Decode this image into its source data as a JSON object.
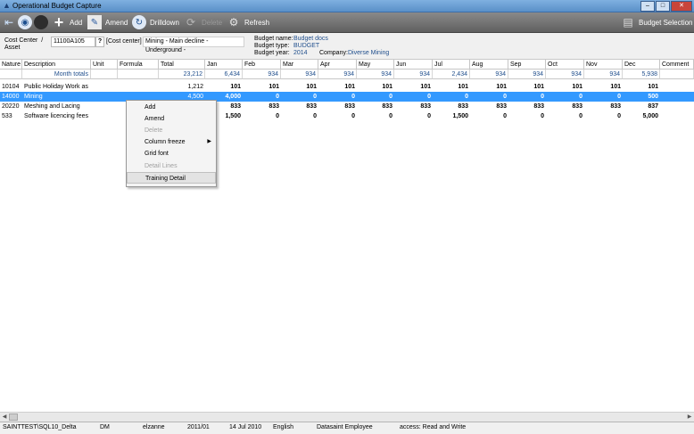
{
  "window": {
    "title": "Operational Budget Capture"
  },
  "toolbar": {
    "add": "Add",
    "amend": "Amend",
    "drilldown": "Drilldown",
    "delete": "Delete",
    "refresh": "Refresh",
    "budget_selection": "Budget Selection"
  },
  "header": {
    "cost_center_label": "Cost Center  /\nAsset",
    "cost_center_code": "11100A105",
    "cost_center_type": "[Cost center]",
    "cost_center_desc": "Mining - Main decline - Underground -",
    "budget_name_label": "Budget name:",
    "budget_name": "Budget docs",
    "budget_type_label": "Budget type:",
    "budget_type": "BUDGET",
    "budget_year_label": "Budget year:",
    "budget_year": "2014",
    "company_label": "Company:",
    "company": "Diverse Mining"
  },
  "grid": {
    "columns": [
      "Nature",
      "Description",
      "Unit",
      "Formula",
      "Total",
      "Jan",
      "Feb",
      "Mar",
      "Apr",
      "May",
      "Jun",
      "Jul",
      "Aug",
      "Sep",
      "Oct",
      "Nov",
      "Dec",
      "Comment"
    ],
    "totals": [
      "",
      "Month totals",
      "",
      "",
      "23,212",
      "6,434",
      "934",
      "934",
      "934",
      "934",
      "934",
      "2,434",
      "934",
      "934",
      "934",
      "934",
      "5,938",
      ""
    ],
    "rows": [
      [
        "10104",
        "Public Holiday Work as",
        "",
        "",
        "1,212",
        "101",
        "101",
        "101",
        "101",
        "101",
        "101",
        "101",
        "101",
        "101",
        "101",
        "101",
        "101",
        ""
      ],
      [
        "14000",
        "Mining",
        "",
        "",
        "4,500",
        "4,000",
        "0",
        "0",
        "0",
        "0",
        "0",
        "0",
        "0",
        "0",
        "0",
        "0",
        "500",
        ""
      ],
      [
        "20220",
        "Meshing and Lacing",
        "",
        "",
        "",
        "833",
        "833",
        "833",
        "833",
        "833",
        "833",
        "833",
        "833",
        "833",
        "833",
        "833",
        "837",
        ""
      ],
      [
        "533",
        "Software licencing fees",
        "",
        "",
        "",
        "1,500",
        "0",
        "0",
        "0",
        "0",
        "0",
        "1,500",
        "0",
        "0",
        "0",
        "0",
        "5,000",
        ""
      ]
    ]
  },
  "context_menu": {
    "items": [
      "Add",
      "Amend",
      "Delete",
      "Column freeze",
      "Grid font",
      "Detail Lines",
      "Training Detail"
    ]
  },
  "status": {
    "server": "SAINTTEST\\SQL10_Delta",
    "code": "DM",
    "user": "elzanne",
    "period": "2011/01",
    "date": "14 Jul 2010",
    "language": "English",
    "role": "Datasaint Employee",
    "access": "access: Read and Write"
  }
}
